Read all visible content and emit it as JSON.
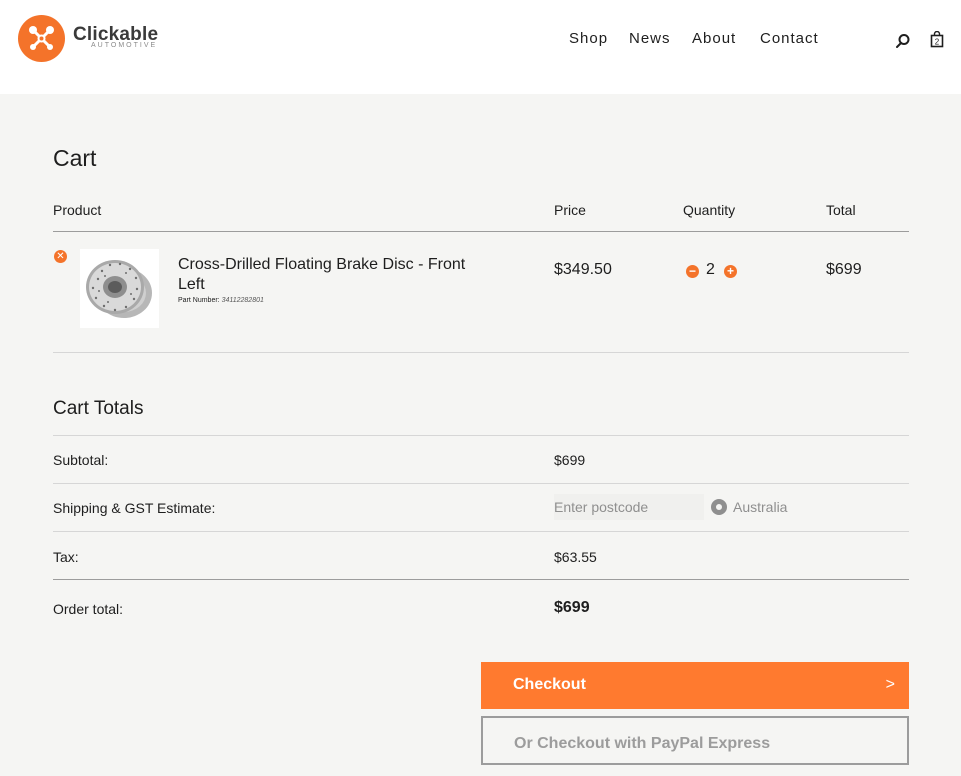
{
  "brand": {
    "name": "Clickable",
    "sub": "AUTOMOTIVE",
    "accent": "#f4732a"
  },
  "nav": {
    "items": [
      "Shop",
      "News",
      "About",
      "Contact"
    ]
  },
  "header_icons": {
    "search": "search-icon",
    "bag": "shopping-bag-icon"
  },
  "cart": {
    "title": "Cart",
    "columns": {
      "product": "Product",
      "price": "Price",
      "quantity": "Quantity",
      "total": "Total"
    },
    "items": [
      {
        "name": "Cross-Drilled Floating Brake Disc - Front Left",
        "part_label": "Part Number:",
        "part_number": "34112282801",
        "price": "$349.50",
        "quantity": "2",
        "total": "$699"
      }
    ]
  },
  "totals": {
    "title": "Cart Totals",
    "subtotal_label": "Subtotal:",
    "subtotal": "$699",
    "shipping_label": "Shipping & GST Estimate:",
    "postcode_placeholder": "Enter postcode",
    "country": "Australia",
    "tax_label": "Tax:",
    "tax": "$63.55",
    "order_total_label": "Order total:",
    "order_total": "$699"
  },
  "actions": {
    "checkout": "Checkout",
    "checkout_arrow": ">",
    "paypal": "Or Checkout with PayPal Express"
  }
}
